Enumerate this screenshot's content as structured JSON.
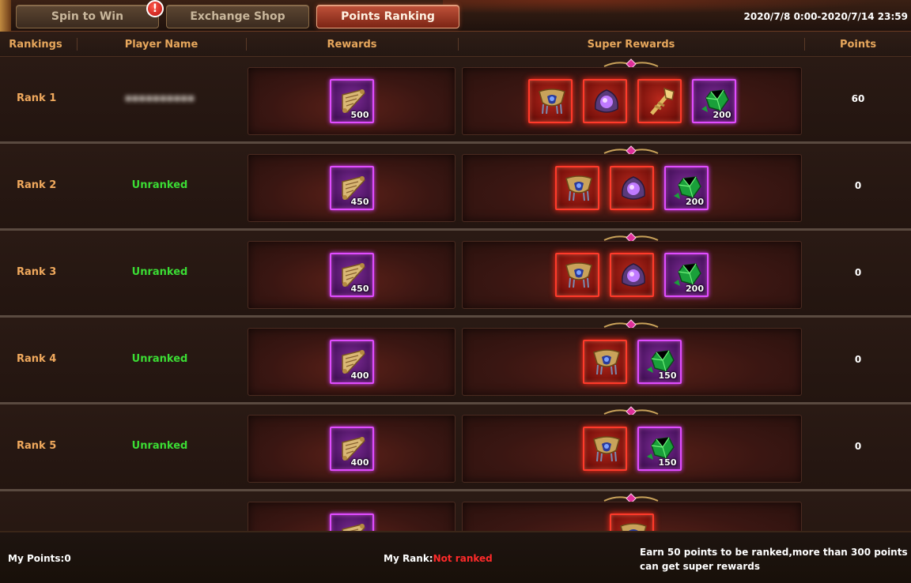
{
  "tabs": [
    {
      "label": "Spin to Win",
      "active": false,
      "alert": true
    },
    {
      "label": "Exchange Shop",
      "active": false,
      "alert": false
    },
    {
      "label": "Points Ranking",
      "active": true,
      "alert": false
    }
  ],
  "alert_badge": "!",
  "date_range": "2020/7/8 0:00-2020/7/14 23:59",
  "columns": {
    "rankings": "Rankings",
    "player_name": "Player Name",
    "rewards": "Rewards",
    "super_rewards": "Super Rewards",
    "points": "Points"
  },
  "rows": [
    {
      "rank": "Rank 1",
      "player": "▪▪▪▪▪▪▪▪▪▪",
      "player_hidden": true,
      "reward_qty": "500",
      "super": [
        {
          "kind": "armor",
          "frame": "red",
          "qty": ""
        },
        {
          "kind": "orb",
          "frame": "red",
          "qty": ""
        },
        {
          "kind": "staff",
          "frame": "red",
          "qty": ""
        },
        {
          "kind": "gem",
          "frame": "purple",
          "qty": "200"
        }
      ],
      "points": "60"
    },
    {
      "rank": "Rank 2",
      "player": "Unranked",
      "player_hidden": false,
      "reward_qty": "450",
      "super": [
        {
          "kind": "armor",
          "frame": "red",
          "qty": ""
        },
        {
          "kind": "orb",
          "frame": "red",
          "qty": ""
        },
        {
          "kind": "gem",
          "frame": "purple",
          "qty": "200"
        }
      ],
      "points": "0"
    },
    {
      "rank": "Rank 3",
      "player": "Unranked",
      "player_hidden": false,
      "reward_qty": "450",
      "super": [
        {
          "kind": "armor",
          "frame": "red",
          "qty": ""
        },
        {
          "kind": "orb",
          "frame": "red",
          "qty": ""
        },
        {
          "kind": "gem",
          "frame": "purple",
          "qty": "200"
        }
      ],
      "points": "0"
    },
    {
      "rank": "Rank 4",
      "player": "Unranked",
      "player_hidden": false,
      "reward_qty": "400",
      "super": [
        {
          "kind": "armor",
          "frame": "red",
          "qty": ""
        },
        {
          "kind": "gem",
          "frame": "purple",
          "qty": "150"
        }
      ],
      "points": "0"
    },
    {
      "rank": "Rank 5",
      "player": "Unranked",
      "player_hidden": false,
      "reward_qty": "400",
      "super": [
        {
          "kind": "armor",
          "frame": "red",
          "qty": ""
        },
        {
          "kind": "gem",
          "frame": "purple",
          "qty": "150"
        }
      ],
      "points": "0"
    },
    {
      "rank": "",
      "player": "",
      "player_hidden": false,
      "reward_qty": "",
      "super": [
        {
          "kind": "armor",
          "frame": "red",
          "qty": ""
        }
      ],
      "points": ""
    }
  ],
  "footer": {
    "my_points_label": "My Points:",
    "my_points_value": "0",
    "my_rank_label": "My Rank:",
    "my_rank_value": "Not ranked",
    "hint": "Earn 50 points to be ranked,more than 300 points can get super rewards"
  },
  "colors": {
    "rank_text": "#f0a95d",
    "unranked_text": "#3bdc34",
    "not_ranked_text": "#ff2a2a",
    "active_tab": "#c0523a"
  }
}
